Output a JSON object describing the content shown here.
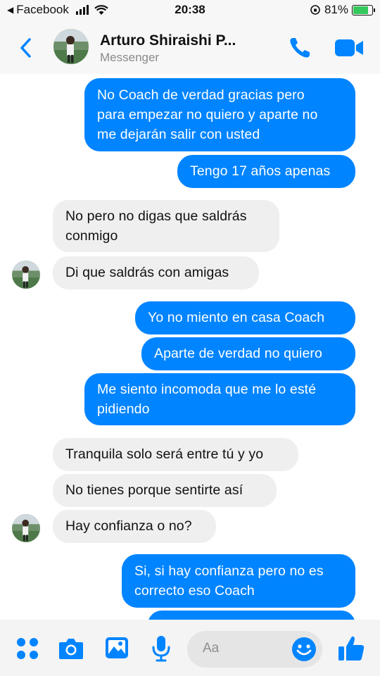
{
  "status_bar": {
    "back_app": "Facebook",
    "time": "20:38",
    "battery": "81%",
    "battery_level": 0.81
  },
  "header": {
    "contact_name": "Arturo Shiraishi P...",
    "subtitle": "Messenger"
  },
  "messages": [
    {
      "direction": "out",
      "lines": [
        "No Coach de verdad gracias pero",
        "para empezar no quiero y aparte no",
        "me dejarán salir con usted"
      ]
    },
    {
      "direction": "out",
      "lines": [
        "Tengo 17 años apenas"
      ]
    },
    {
      "direction": "in",
      "lines": [
        "No pero no digas que saldrás",
        "conmigo"
      ]
    },
    {
      "direction": "in",
      "lines": [
        "Di que saldrás con amigas"
      ]
    },
    {
      "direction": "out",
      "lines": [
        "Yo no miento en casa Coach"
      ]
    },
    {
      "direction": "out",
      "lines": [
        "Aparte de verdad no quiero"
      ]
    },
    {
      "direction": "out",
      "lines": [
        "Me siento incomoda que me lo esté",
        "pidiendo"
      ]
    },
    {
      "direction": "in",
      "lines": [
        "Tranquila solo será entre tú y yo"
      ]
    },
    {
      "direction": "in",
      "lines": [
        "No tienes porque sentirte así"
      ]
    },
    {
      "direction": "in",
      "lines": [
        "Hay confianza o no?"
      ]
    },
    {
      "direction": "out",
      "lines": [
        "Si, si hay confianza pero no es",
        "correcto eso Coach"
      ]
    }
  ],
  "composer": {
    "placeholder": "Aa"
  },
  "icons": {
    "back": "chevron-left-icon",
    "call": "phone-icon",
    "video": "video-camera-icon",
    "apps": "four-dots-icon",
    "camera": "camera-icon",
    "gallery": "image-icon",
    "mic": "microphone-icon",
    "emoji": "smiley-icon",
    "like": "thumbs-up-icon"
  },
  "colors": {
    "accent": "#0084ff",
    "incoming_bubble": "#efefef"
  }
}
